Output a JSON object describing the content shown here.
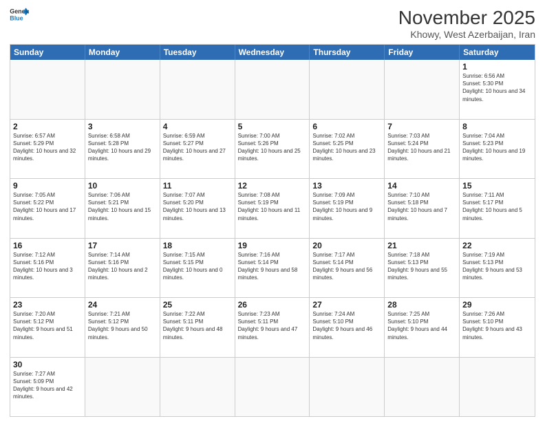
{
  "header": {
    "logo_general": "General",
    "logo_blue": "Blue",
    "month_title": "November 2025",
    "location": "Khowy, West Azerbaijan, Iran"
  },
  "weekdays": [
    "Sunday",
    "Monday",
    "Tuesday",
    "Wednesday",
    "Thursday",
    "Friday",
    "Saturday"
  ],
  "rows": [
    [
      {
        "day": "",
        "info": ""
      },
      {
        "day": "",
        "info": ""
      },
      {
        "day": "",
        "info": ""
      },
      {
        "day": "",
        "info": ""
      },
      {
        "day": "",
        "info": ""
      },
      {
        "day": "",
        "info": ""
      },
      {
        "day": "1",
        "info": "Sunrise: 6:56 AM\nSunset: 5:30 PM\nDaylight: 10 hours and 34 minutes."
      }
    ],
    [
      {
        "day": "2",
        "info": "Sunrise: 6:57 AM\nSunset: 5:29 PM\nDaylight: 10 hours and 32 minutes."
      },
      {
        "day": "3",
        "info": "Sunrise: 6:58 AM\nSunset: 5:28 PM\nDaylight: 10 hours and 29 minutes."
      },
      {
        "day": "4",
        "info": "Sunrise: 6:59 AM\nSunset: 5:27 PM\nDaylight: 10 hours and 27 minutes."
      },
      {
        "day": "5",
        "info": "Sunrise: 7:00 AM\nSunset: 5:26 PM\nDaylight: 10 hours and 25 minutes."
      },
      {
        "day": "6",
        "info": "Sunrise: 7:02 AM\nSunset: 5:25 PM\nDaylight: 10 hours and 23 minutes."
      },
      {
        "day": "7",
        "info": "Sunrise: 7:03 AM\nSunset: 5:24 PM\nDaylight: 10 hours and 21 minutes."
      },
      {
        "day": "8",
        "info": "Sunrise: 7:04 AM\nSunset: 5:23 PM\nDaylight: 10 hours and 19 minutes."
      }
    ],
    [
      {
        "day": "9",
        "info": "Sunrise: 7:05 AM\nSunset: 5:22 PM\nDaylight: 10 hours and 17 minutes."
      },
      {
        "day": "10",
        "info": "Sunrise: 7:06 AM\nSunset: 5:21 PM\nDaylight: 10 hours and 15 minutes."
      },
      {
        "day": "11",
        "info": "Sunrise: 7:07 AM\nSunset: 5:20 PM\nDaylight: 10 hours and 13 minutes."
      },
      {
        "day": "12",
        "info": "Sunrise: 7:08 AM\nSunset: 5:19 PM\nDaylight: 10 hours and 11 minutes."
      },
      {
        "day": "13",
        "info": "Sunrise: 7:09 AM\nSunset: 5:19 PM\nDaylight: 10 hours and 9 minutes."
      },
      {
        "day": "14",
        "info": "Sunrise: 7:10 AM\nSunset: 5:18 PM\nDaylight: 10 hours and 7 minutes."
      },
      {
        "day": "15",
        "info": "Sunrise: 7:11 AM\nSunset: 5:17 PM\nDaylight: 10 hours and 5 minutes."
      }
    ],
    [
      {
        "day": "16",
        "info": "Sunrise: 7:12 AM\nSunset: 5:16 PM\nDaylight: 10 hours and 3 minutes."
      },
      {
        "day": "17",
        "info": "Sunrise: 7:14 AM\nSunset: 5:16 PM\nDaylight: 10 hours and 2 minutes."
      },
      {
        "day": "18",
        "info": "Sunrise: 7:15 AM\nSunset: 5:15 PM\nDaylight: 10 hours and 0 minutes."
      },
      {
        "day": "19",
        "info": "Sunrise: 7:16 AM\nSunset: 5:14 PM\nDaylight: 9 hours and 58 minutes."
      },
      {
        "day": "20",
        "info": "Sunrise: 7:17 AM\nSunset: 5:14 PM\nDaylight: 9 hours and 56 minutes."
      },
      {
        "day": "21",
        "info": "Sunrise: 7:18 AM\nSunset: 5:13 PM\nDaylight: 9 hours and 55 minutes."
      },
      {
        "day": "22",
        "info": "Sunrise: 7:19 AM\nSunset: 5:13 PM\nDaylight: 9 hours and 53 minutes."
      }
    ],
    [
      {
        "day": "23",
        "info": "Sunrise: 7:20 AM\nSunset: 5:12 PM\nDaylight: 9 hours and 51 minutes."
      },
      {
        "day": "24",
        "info": "Sunrise: 7:21 AM\nSunset: 5:12 PM\nDaylight: 9 hours and 50 minutes."
      },
      {
        "day": "25",
        "info": "Sunrise: 7:22 AM\nSunset: 5:11 PM\nDaylight: 9 hours and 48 minutes."
      },
      {
        "day": "26",
        "info": "Sunrise: 7:23 AM\nSunset: 5:11 PM\nDaylight: 9 hours and 47 minutes."
      },
      {
        "day": "27",
        "info": "Sunrise: 7:24 AM\nSunset: 5:10 PM\nDaylight: 9 hours and 46 minutes."
      },
      {
        "day": "28",
        "info": "Sunrise: 7:25 AM\nSunset: 5:10 PM\nDaylight: 9 hours and 44 minutes."
      },
      {
        "day": "29",
        "info": "Sunrise: 7:26 AM\nSunset: 5:10 PM\nDaylight: 9 hours and 43 minutes."
      }
    ],
    [
      {
        "day": "30",
        "info": "Sunrise: 7:27 AM\nSunset: 5:09 PM\nDaylight: 9 hours and 42 minutes."
      },
      {
        "day": "",
        "info": ""
      },
      {
        "day": "",
        "info": ""
      },
      {
        "day": "",
        "info": ""
      },
      {
        "day": "",
        "info": ""
      },
      {
        "day": "",
        "info": ""
      },
      {
        "day": "",
        "info": ""
      }
    ]
  ]
}
